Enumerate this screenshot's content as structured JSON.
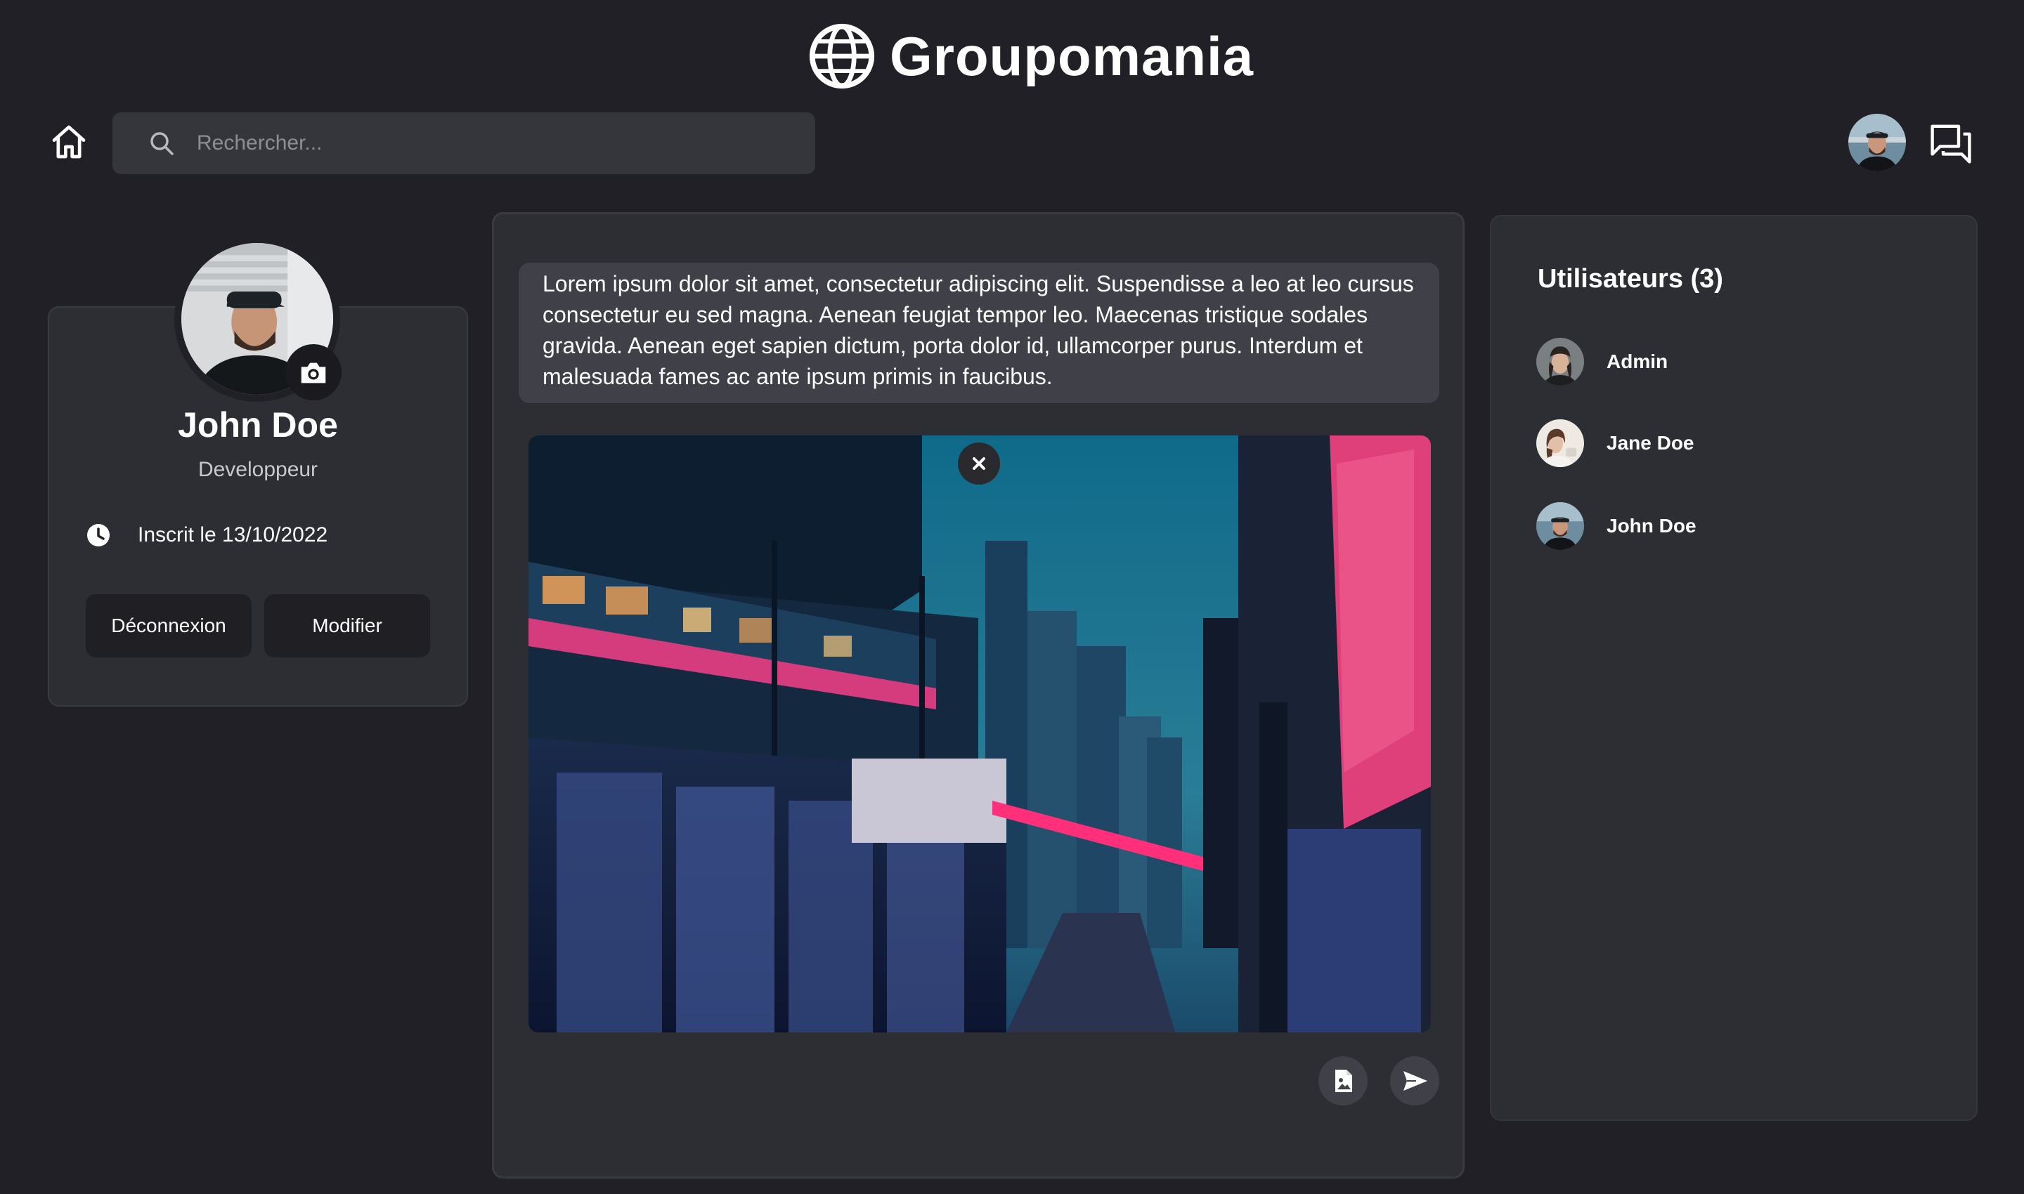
{
  "app": {
    "name": "Groupomania"
  },
  "header": {
    "search_placeholder": "Rechercher..."
  },
  "profile": {
    "name": "John Doe",
    "role": "Developpeur",
    "joined": "Inscrit le 13/10/2022",
    "logout_label": "Déconnexion",
    "edit_label": "Modifier"
  },
  "post": {
    "text": "Lorem ipsum dolor sit amet, consectetur adipiscing elit. Suspendisse a leo at leo cursus consectetur eu sed magna. Aenean feugiat tempor leo. Maecenas tristique sodales gravida. Aenean eget sapien dictum, porta dolor id, ullamcorper purus. Interdum et malesuada fames ac ante ipsum primis in faucibus."
  },
  "users": {
    "title": "Utilisateurs (3)",
    "items": [
      {
        "name": "Admin"
      },
      {
        "name": "Jane Doe"
      },
      {
        "name": "John Doe"
      }
    ]
  },
  "colors": {
    "background": "#202026",
    "card": "#2d2e33",
    "input": "#35363c",
    "text_area": "#404148"
  }
}
